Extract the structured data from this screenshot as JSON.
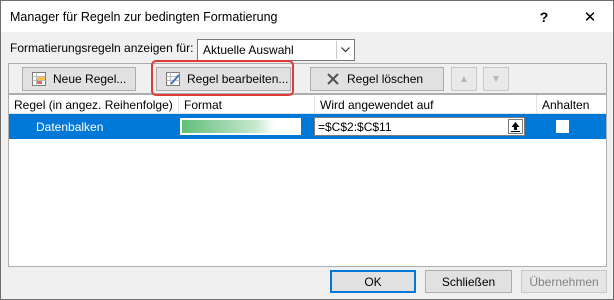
{
  "window": {
    "title": "Manager für Regeln zur bedingten Formatierung",
    "help_glyph": "?",
    "close_glyph": "✕"
  },
  "filter": {
    "label": "Formatierungsregeln anzeigen für:",
    "selected": "Aktuelle Auswahl"
  },
  "toolbar": {
    "new_rule": "Neue Regel...",
    "edit_rule": "Regel bearbeiten...",
    "delete_rule": "Regel löschen",
    "move_up_glyph": "▲",
    "move_down_glyph": "▼"
  },
  "grid": {
    "columns": [
      "Regel (in angez. Reihenfolge)",
      "Format",
      "Wird angewendet auf",
      "Anhalten"
    ],
    "rows": [
      {
        "rule": "Datenbalken",
        "format": "data-bar-preview",
        "applies_to": "=$C$2:$C$11",
        "stop_if_true": false
      }
    ]
  },
  "footer": {
    "ok": "OK",
    "close": "Schließen",
    "apply": "Übernehmen"
  },
  "colors": {
    "selection": "#0078d7",
    "highlight": "#e03b3b",
    "databar": "#63be7b"
  }
}
